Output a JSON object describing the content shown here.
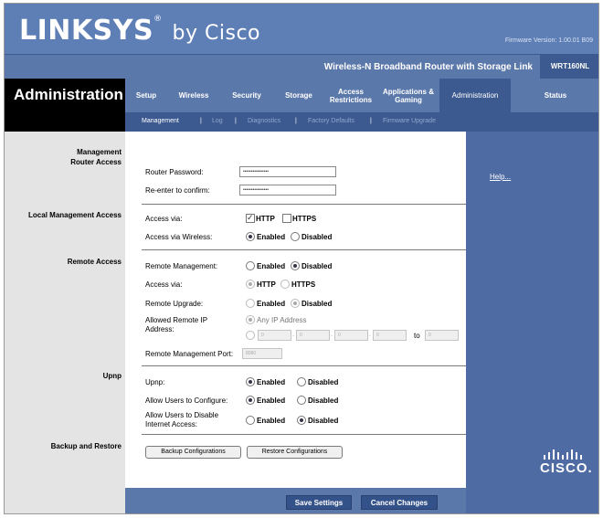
{
  "header": {
    "brand": "LINKSYS",
    "brand_suffix": "by Cisco",
    "firmware": "Firmware Version: 1.00.01 B09",
    "product_name": "Wireless-N Broadband Router with Storage Link",
    "model": "WRT160NL",
    "section_title": "Administration"
  },
  "tabs": [
    {
      "label": "Setup"
    },
    {
      "label": "Wireless"
    },
    {
      "label": "Security"
    },
    {
      "label": "Storage"
    },
    {
      "label": "Access Restrictions"
    },
    {
      "label": "Applications & Gaming"
    },
    {
      "label": "Administration"
    },
    {
      "label": "Status"
    }
  ],
  "subtabs": [
    "Management",
    "Log",
    "Diagnostics",
    "Factory Defaults",
    "Firmware Upgrade"
  ],
  "left_labels": {
    "management": "Management",
    "router_access": "Router Access",
    "local_management_access": "Local Management Access",
    "remote_access": "Remote Access",
    "upnp": "Upnp",
    "backup_restore": "Backup and Restore"
  },
  "router_access": {
    "password_label": "Router Password:",
    "password_value": "••••••••••••••••",
    "confirm_label": "Re-enter to confirm:",
    "confirm_value": "••••••••••••••••"
  },
  "local_access": {
    "access_via_label": "Access via:",
    "http": "HTTP",
    "https": "HTTPS",
    "wireless_label": "Access via Wireless:",
    "enabled": "Enabled",
    "disabled": "Disabled"
  },
  "remote_access": {
    "remote_mgmt_label": "Remote Management:",
    "access_via_label": "Access via:",
    "upgrade_label": "Remote Upgrade:",
    "allowed_ip_label": "Allowed Remote IP Address:",
    "any_ip": "Any IP Address",
    "ip": [
      "0",
      "0",
      "0",
      "0"
    ],
    "ip_to": "0",
    "to_label": "to",
    "port_label": "Remote Management Port:",
    "port_value": "8080"
  },
  "upnp": {
    "upnp_label": "Upnp:",
    "configure_label": "Allow Users to Configure:",
    "disable_label": "Allow Users to Disable Internet Access:"
  },
  "backup": {
    "backup_button": "Backup Configurations",
    "restore_button": "Restore Configurations"
  },
  "footer": {
    "save": "Save Settings",
    "cancel": "Cancel Changes"
  },
  "help": "Help...",
  "cisco": "CISCO."
}
